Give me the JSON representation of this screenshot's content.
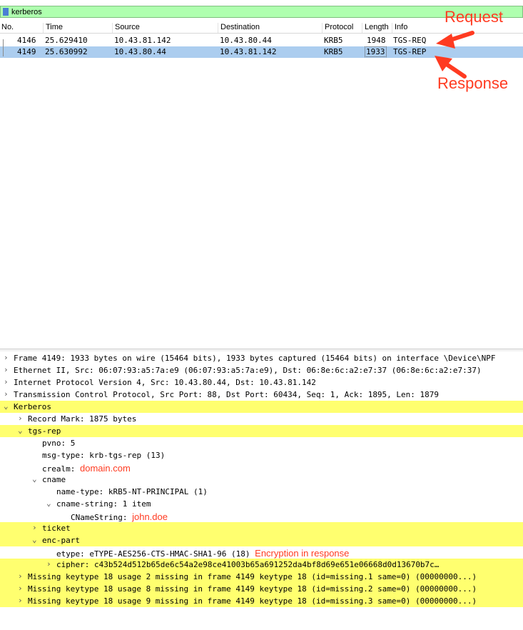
{
  "filter": {
    "value": "kerberos"
  },
  "packet_list": {
    "columns": [
      "No.",
      "Time",
      "Source",
      "Destination",
      "Protocol",
      "Length",
      "Info"
    ],
    "rows": [
      {
        "no": "4146",
        "time": "25.629410",
        "source": "10.43.81.142",
        "destination": "10.43.80.44",
        "protocol": "KRB5",
        "length": "1948",
        "info": "TGS-REQ"
      },
      {
        "no": "4149",
        "time": "25.630992",
        "source": "10.43.80.44",
        "destination": "10.43.81.142",
        "protocol": "KRB5",
        "length": "1933",
        "info": "TGS-REP"
      }
    ]
  },
  "annotations": {
    "request": "Request",
    "response": "Response",
    "domain": "domain.com",
    "user": "john.doe",
    "encryption": "Encryption  in response"
  },
  "details": [
    {
      "indent": 0,
      "arrow": "›",
      "text": "Frame 4149: 1933 bytes on wire (15464 bits), 1933 bytes captured (15464 bits) on interface \\Device\\NPF",
      "hl": false
    },
    {
      "indent": 0,
      "arrow": "›",
      "text": "Ethernet II, Src: 06:07:93:a5:7a:e9 (06:07:93:a5:7a:e9), Dst: 06:8e:6c:a2:e7:37 (06:8e:6c:a2:e7:37)",
      "hl": false
    },
    {
      "indent": 0,
      "arrow": "›",
      "text": "Internet Protocol Version 4, Src: 10.43.80.44, Dst: 10.43.81.142",
      "hl": false
    },
    {
      "indent": 0,
      "arrow": "›",
      "text": "Transmission Control Protocol, Src Port: 88, Dst Port: 60434, Seq: 1, Ack: 1895, Len: 1879",
      "hl": false
    },
    {
      "indent": 0,
      "arrow": "⌄",
      "text": "Kerberos",
      "hl": true
    },
    {
      "indent": 1,
      "arrow": "›",
      "text": "Record Mark: 1875 bytes",
      "hl": false
    },
    {
      "indent": 1,
      "arrow": "⌄",
      "text": "tgs-rep",
      "hl": true
    },
    {
      "indent": 2,
      "arrow": "",
      "text": "pvno: 5",
      "hl": false
    },
    {
      "indent": 2,
      "arrow": "",
      "text": "msg-type: krb-tgs-rep (13)",
      "hl": false
    },
    {
      "indent": 2,
      "arrow": "",
      "text": "crealm: ",
      "hl": false,
      "annot": "domain"
    },
    {
      "indent": 2,
      "arrow": "⌄",
      "text": "cname",
      "hl": false
    },
    {
      "indent": 3,
      "arrow": "",
      "text": "name-type: kRB5-NT-PRINCIPAL (1)",
      "hl": false
    },
    {
      "indent": 3,
      "arrow": "⌄",
      "text": "cname-string: 1 item",
      "hl": false
    },
    {
      "indent": 4,
      "arrow": "",
      "text": "CNameString: ",
      "hl": false,
      "annot": "user"
    },
    {
      "indent": 2,
      "arrow": "›",
      "text": "ticket",
      "hl": true
    },
    {
      "indent": 2,
      "arrow": "⌄",
      "text": "enc-part",
      "hl": true
    },
    {
      "indent": 3,
      "arrow": "",
      "text": "etype: eTYPE-AES256-CTS-HMAC-SHA1-96 (18)   ",
      "hl": false,
      "annot": "encryption"
    },
    {
      "indent": 3,
      "arrow": "›",
      "text": "cipher: c43b524d512b65de6c54a2e98ce41003b65a691252da4bf8d69e651e06668d0d13670b7c…",
      "hl": true
    },
    {
      "indent": 1,
      "arrow": "›",
      "text": "Missing keytype 18 usage 2 missing in frame 4149 keytype 18 (id=missing.1 same=0) (00000000...)",
      "hl": true
    },
    {
      "indent": 1,
      "arrow": "›",
      "text": "Missing keytype 18 usage 8 missing in frame 4149 keytype 18 (id=missing.2 same=0) (00000000...)",
      "hl": true
    },
    {
      "indent": 1,
      "arrow": "›",
      "text": "Missing keytype 18 usage 9 missing in frame 4149 keytype 18 (id=missing.3 same=0) (00000000...)",
      "hl": true
    }
  ],
  "colors": {
    "filter_bg": "#afffaf",
    "selected_row": "#abcdef",
    "highlight": "#ffff6f",
    "annotation": "#ff3b21"
  }
}
